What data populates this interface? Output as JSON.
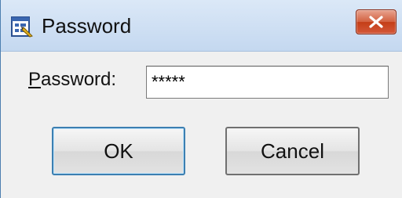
{
  "window": {
    "title": "Password",
    "icon": "dialog-app-icon",
    "close_icon": "close-icon"
  },
  "form": {
    "password_label_mnemonic": "P",
    "password_label_rest": "assword:",
    "password_value": "*****"
  },
  "buttons": {
    "ok_label": "OK",
    "cancel_label": "Cancel"
  },
  "colors": {
    "close_button": "#c43e17",
    "titlebar": "#c4d8f0",
    "background": "#f0f0f0"
  }
}
